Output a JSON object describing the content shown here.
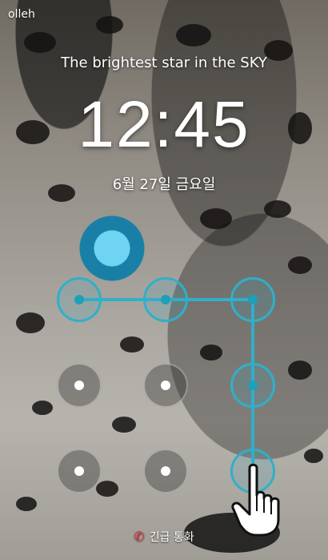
{
  "status_bar": {
    "carrier": "olleh"
  },
  "lock_screen": {
    "tagline": "The brightest star in the SKY",
    "time": "12:45",
    "date": "6월 27일 금요일"
  },
  "pattern": {
    "grid": "3x3",
    "selected_sequence": [
      1,
      2,
      3,
      6,
      9
    ],
    "accent_color": "#2fb0c9"
  },
  "emergency_call": {
    "label": "긴급 통화",
    "icon": "phone-icon"
  }
}
